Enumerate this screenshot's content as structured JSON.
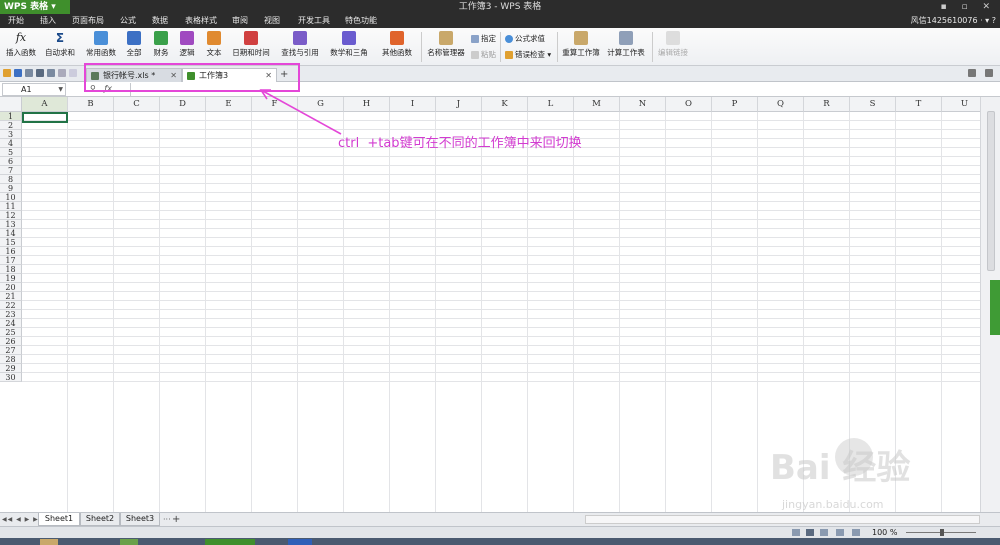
{
  "app": {
    "name": "WPS 表格",
    "window_title": "工作簿3 - WPS 表格",
    "window_controls": "▪ ▫ ✕"
  },
  "menu": [
    "开始",
    "插入",
    "页面布局",
    "公式",
    "数据",
    "表格样式",
    "审阅",
    "视图",
    "开发工具",
    "特色功能"
  ],
  "user": "风信1425610076 ·  ▾ ?",
  "ribbon": {
    "insert_function": "插入函数",
    "autosum": "自动求和",
    "common": "常用函数",
    "all": "全部",
    "finance": "财务",
    "logic": "逻辑",
    "text": "文本",
    "datetime": "日期和时间",
    "lookup": "查找与引用",
    "math": "数学和三角",
    "other": "其他函数",
    "name_manager": "名称管理器",
    "assign": "指定",
    "paste": "粘贴",
    "formula_eval": "公式求值",
    "error_check": "错误检查",
    "recalc_workbook": "重算工作簿",
    "calc_sheet": "计算工作表",
    "edit_link": "编辑链接"
  },
  "doc_tabs": [
    {
      "name": "银行帐号.xls *",
      "active": false
    },
    {
      "name": "工作簿3",
      "active": true
    }
  ],
  "tab_add": "+",
  "name_box": "A1",
  "fx": "ƒx",
  "columns": [
    "A",
    "B",
    "C",
    "D",
    "E",
    "F",
    "G",
    "H",
    "I",
    "J",
    "K",
    "L",
    "M",
    "N",
    "O",
    "P",
    "Q",
    "R",
    "S",
    "T",
    "U"
  ],
  "rows": [
    "1",
    "2",
    "3",
    "4",
    "5",
    "6",
    "7",
    "8",
    "9",
    "10",
    "11",
    "12",
    "13",
    "14",
    "15",
    "16",
    "17",
    "18",
    "19",
    "20",
    "21",
    "22",
    "23",
    "24",
    "25",
    "26",
    "27",
    "28",
    "29",
    "30"
  ],
  "sheets": [
    "Sheet1",
    "Sheet2",
    "Sheet3"
  ],
  "active_sheet": "Sheet1",
  "sheet_add": "+",
  "zoom": "100 %",
  "annotation": {
    "part1": "ctrl",
    "part2": "+tab",
    "part3": "键可在不同的工作簿中来回切换"
  },
  "watermark": {
    "text": "Bai 经验",
    "url": "jingyan.baidu.com"
  },
  "colors": {
    "accent": "#3f8f2c",
    "highlight": "#e447d8",
    "active_cell": "#217346"
  }
}
